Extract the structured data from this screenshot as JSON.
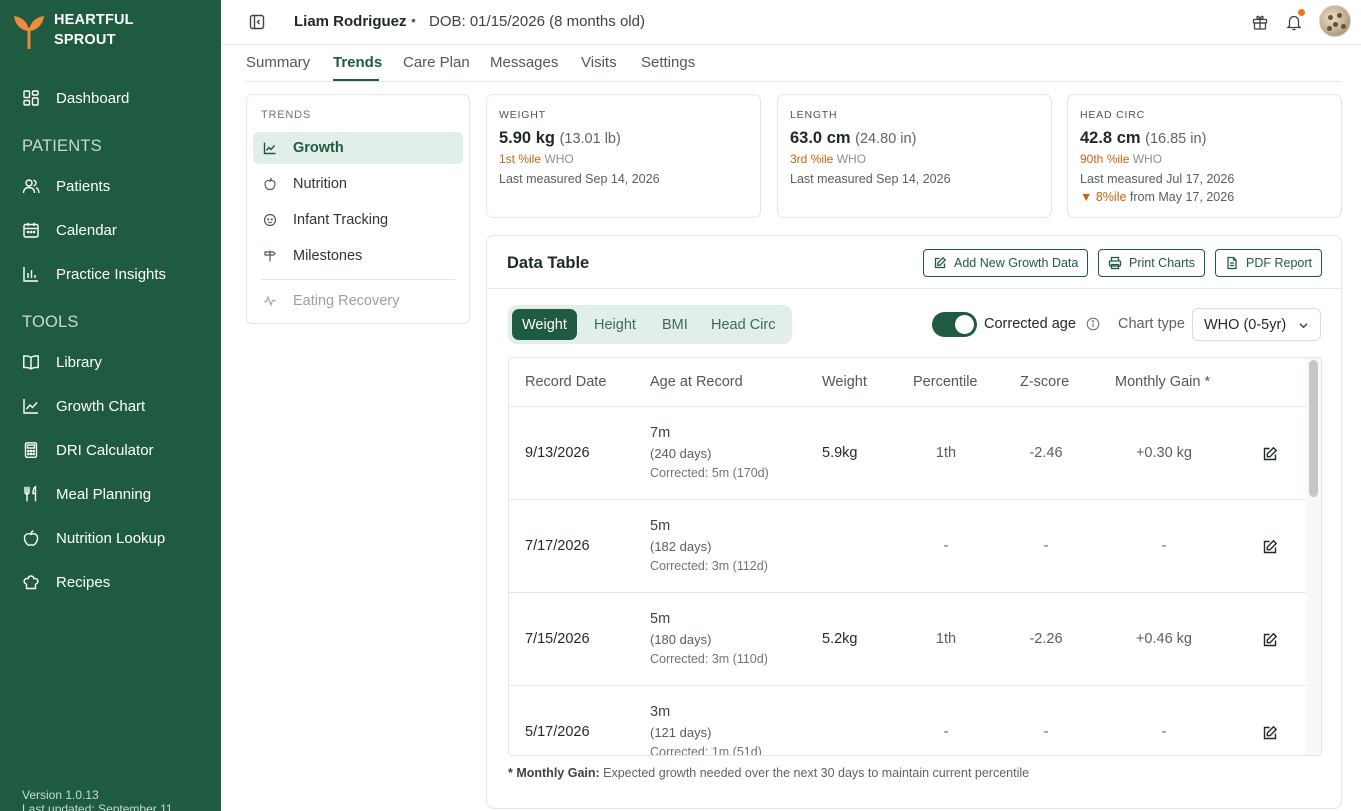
{
  "brand": {
    "line1": "HEARTFUL",
    "line2": "SPROUT"
  },
  "sidebar": {
    "dashboard": "Dashboard",
    "patients_section": "PATIENTS",
    "tools_section": "TOOLS",
    "items": {
      "patients": "Patients",
      "calendar": "Calendar",
      "practice_insights": "Practice Insights",
      "library": "Library",
      "growth_chart": "Growth Chart",
      "dri_calculator": "DRI Calculator",
      "meal_planning": "Meal Planning",
      "nutrition_lookup": "Nutrition Lookup",
      "recipes": "Recipes"
    },
    "version": "Version 1.0.13",
    "last_updated": "Last updated: September 11"
  },
  "header": {
    "patient_name": "Liam Rodriguez",
    "separator": "•",
    "dob": "DOB: 01/15/2026 (8 months old)"
  },
  "tabs": [
    "Summary",
    "Trends",
    "Care Plan",
    "Messages",
    "Visits",
    "Settings"
  ],
  "trends": {
    "label": "TRENDS",
    "items": [
      "Growth",
      "Nutrition",
      "Infant Tracking",
      "Milestones",
      "Eating Recovery"
    ]
  },
  "metrics": {
    "weight": {
      "label": "WEIGHT",
      "value": "5.90 kg",
      "alt": "(13.01 lb)",
      "pct": "1st %ile",
      "ref": "WHO",
      "last": "Last measured Sep 14, 2026"
    },
    "length": {
      "label": "LENGTH",
      "value": "63.0 cm",
      "alt": "(24.80 in)",
      "pct": "3rd %ile",
      "ref": "WHO",
      "last": "Last measured Sep 14, 2026"
    },
    "head": {
      "label": "HEAD CIRC",
      "value": "42.8 cm",
      "alt": "(16.85 in)",
      "pct": "90th %ile",
      "ref": "WHO",
      "last": "Last measured Jul 17, 2026",
      "delta_arrow": "▼",
      "delta": "8%ile",
      "delta_from": "from May 17, 2026"
    }
  },
  "data_table": {
    "title": "Data Table",
    "buttons": {
      "add": "Add New Growth Data",
      "print": "Print Charts",
      "pdf": "PDF Report"
    },
    "segments": [
      "Weight",
      "Height",
      "BMI",
      "Head Circ"
    ],
    "corrected_age_label": "Corrected age",
    "chart_type_label": "Chart type",
    "chart_type_value": "WHO (0-5yr)",
    "columns": [
      "Record Date",
      "Age at Record",
      "Weight",
      "Percentile",
      "Z-score",
      "Monthly Gain *"
    ],
    "rows": [
      {
        "date": "9/13/2026",
        "age": "7m",
        "days": "(240 days)",
        "corrected": "Corrected: 5m (170d)",
        "weight": "5.9kg",
        "percentile": "1th",
        "z": "-2.46",
        "gain": "+0.30 kg"
      },
      {
        "date": "7/17/2026",
        "age": "5m",
        "days": "(182 days)",
        "corrected": "Corrected: 3m (112d)",
        "weight": "",
        "percentile": "-",
        "z": "-",
        "gain": "-"
      },
      {
        "date": "7/15/2026",
        "age": "5m",
        "days": "(180 days)",
        "corrected": "Corrected: 3m (110d)",
        "weight": "5.2kg",
        "percentile": "1th",
        "z": "-2.26",
        "gain": "+0.46 kg"
      },
      {
        "date": "5/17/2026",
        "age": "3m",
        "days": "(121 days)",
        "corrected": "Corrected: 1m (51d)",
        "weight": "",
        "percentile": "-",
        "z": "-",
        "gain": "-"
      }
    ],
    "footnote_label": "* Monthly Gain:",
    "footnote_text": " Expected growth needed over the next 30 days to maintain current percentile"
  },
  "colors": {
    "sidebar": "#1e5b40",
    "accent": "#1e5b40",
    "warning": "#c4650f",
    "notification": "#e8791f"
  }
}
